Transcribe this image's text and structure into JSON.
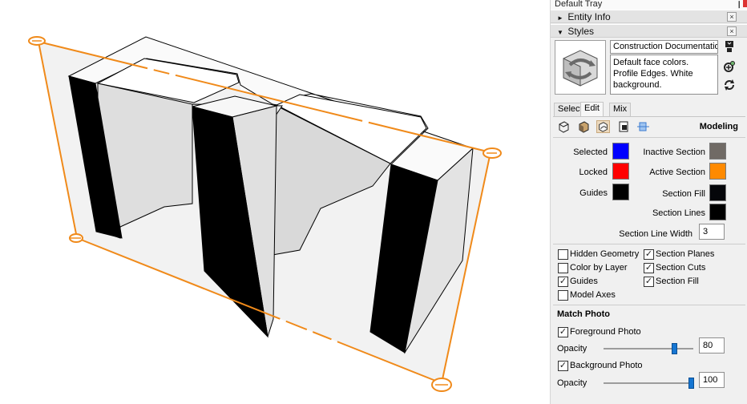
{
  "tray": {
    "title": "Default Tray",
    "pin_glyph": "❙"
  },
  "panels": {
    "entity_info": {
      "label": "Entity Info",
      "collapsed_glyph": "►"
    },
    "styles": {
      "label": "Styles",
      "expanded_glyph": "▼"
    },
    "close_glyph": "×"
  },
  "style": {
    "name": "Construction Documentation",
    "description": "Default face colors. Profile Edges. White background."
  },
  "tabs": {
    "select": "Select",
    "edit": "Edit",
    "mix": "Mix"
  },
  "category": {
    "title": "Modeling"
  },
  "colors": {
    "selected": {
      "label": "Selected",
      "value": "#0000ff"
    },
    "locked": {
      "label": "Locked",
      "value": "#ff0000"
    },
    "guides": {
      "label": "Guides",
      "value": "#000000"
    },
    "inactive_section": {
      "label": "Inactive Section",
      "value": "#706a65"
    },
    "active_section": {
      "label": "Active Section",
      "value": "#ff8a00"
    },
    "section_fill": {
      "label": "Section Fill",
      "value": "#05060a"
    },
    "section_lines": {
      "label": "Section Lines",
      "value": "#000000"
    }
  },
  "section_line_width": {
    "label": "Section Line Width",
    "value": "3"
  },
  "checkboxes": {
    "hidden_geometry": {
      "label": "Hidden Geometry",
      "checked": false
    },
    "color_by_layer": {
      "label": "Color by Layer",
      "checked": false
    },
    "guides": {
      "label": "Guides",
      "checked": true
    },
    "model_axes": {
      "label": "Model Axes",
      "checked": false
    },
    "section_planes": {
      "label": "Section Planes",
      "checked": true
    },
    "section_cuts": {
      "label": "Section Cuts",
      "checked": true
    },
    "section_fill": {
      "label": "Section Fill",
      "checked": true
    },
    "check_glyph": "✓"
  },
  "match_photo": {
    "title": "Match Photo",
    "foreground": {
      "label": "Foreground Photo",
      "checked": true,
      "opacity_label": "Opacity",
      "opacity": "80"
    },
    "background": {
      "label": "Background Photo",
      "checked": true,
      "opacity_label": "Opacity",
      "opacity": "100"
    }
  },
  "accent": {
    "section_plane": "#f08a1a",
    "slider": "#1676d2"
  }
}
